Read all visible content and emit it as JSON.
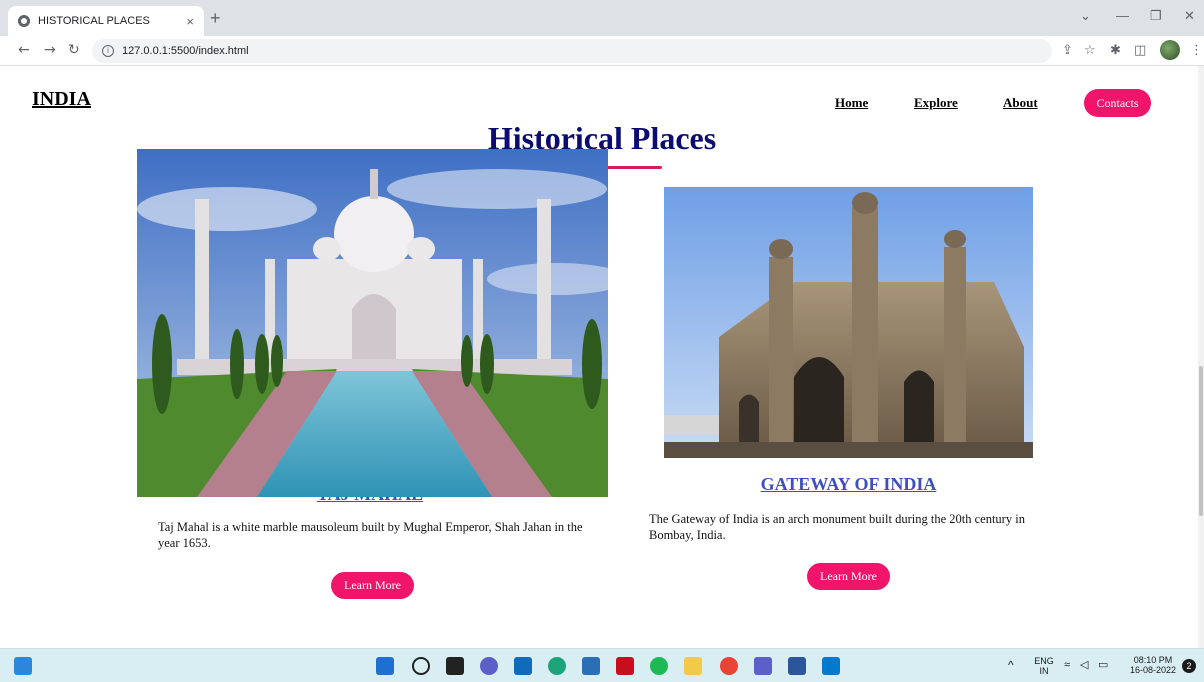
{
  "browser": {
    "tab_title": "HISTORICAL PLACES",
    "tab_close": "×",
    "new_tab": "+",
    "url": "127.0.0.1:5500/index.html"
  },
  "site": {
    "logo": "INDIA",
    "nav": [
      {
        "label": "Home"
      },
      {
        "label": "Explore"
      },
      {
        "label": "About"
      }
    ],
    "contacts_label": "Contacts",
    "page_title": "Historical Places"
  },
  "cards": [
    {
      "title": "TAJ MAHAL",
      "description": "Taj Mahal is a white marble mausoleum built by Mughal Emperor, Shah Jahan in the year 1653.",
      "button": "Learn More"
    },
    {
      "title": "GATEWAY OF INDIA",
      "description": "The Gateway of India is an arch monument built during the 20th century in Bombay, India.",
      "button": "Learn More"
    }
  ],
  "tray": {
    "lang_top": "ENG",
    "lang_bottom": "IN",
    "time": "08:10 PM",
    "date": "16-08-2022",
    "notifications": "2"
  },
  "colors": {
    "accent": "#f0146a",
    "title": "#0b0c73",
    "link": "#3c4ec1"
  }
}
